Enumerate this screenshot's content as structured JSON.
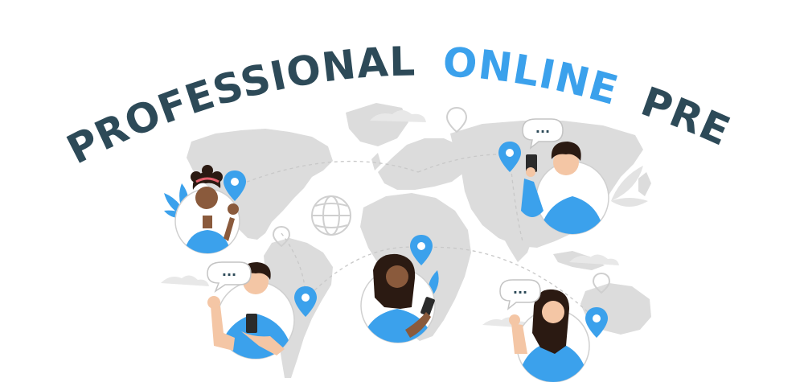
{
  "headline": {
    "word1": "PROFESSIONAL",
    "word2": "ONLINE",
    "word3": "PRESENCE"
  },
  "colors": {
    "dark": "#2d4a58",
    "accent": "#3ba1ec",
    "map": "#dcdcdc",
    "map_dark": "#c9c9c9",
    "skin_light": "#f4c6a5",
    "skin_dark": "#8a5a3c",
    "hair": "#2b1a12"
  },
  "speech_bubbles": {
    "top_right": "...",
    "bottom_left": "...",
    "bottom_right": "..."
  }
}
